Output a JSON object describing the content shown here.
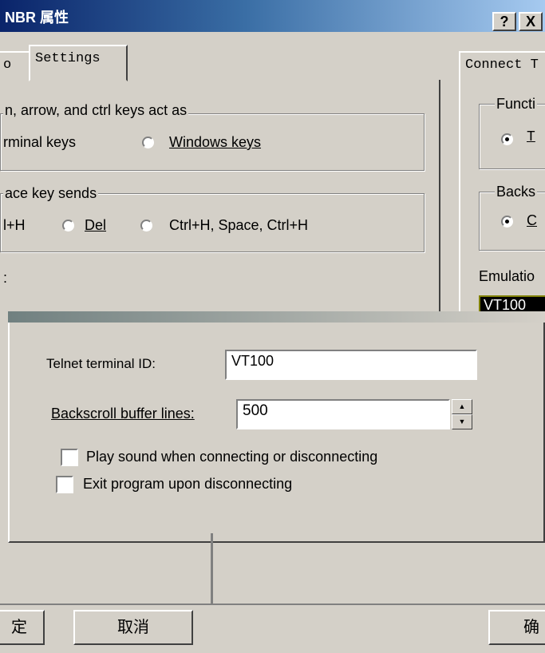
{
  "window": {
    "title": "NBR 属性",
    "help_btn": "?",
    "close_btn": "X"
  },
  "tabs": {
    "partial": "o",
    "settings": "Settings",
    "right_partial": "Connect T"
  },
  "left_panel": {
    "keys_group": "n, arrow, and ctrl keys act as",
    "terminal_keys": "rminal keys",
    "windows_keys": "Windows keys",
    "backspace_group": "ace key sends",
    "opt_ctrlh": "l+H",
    "opt_del": "Del",
    "opt_ctrlh_space": "Ctrl+H, Space, Ctrl+H",
    "colon_label": ":"
  },
  "right_panel": {
    "func_group": "Functi",
    "func_opt": "T",
    "back_group": "Backs",
    "back_opt": "C",
    "emulation_label": "Emulatio",
    "emulation_value": "VT100"
  },
  "dialog": {
    "terminal_id_label": "Telnet terminal ID:",
    "terminal_id_value": "VT100",
    "backscroll_label": "Backscroll buffer lines:",
    "backscroll_value": "500",
    "play_sound_label": "Play sound when connecting or disconnecting",
    "exit_label": "Exit program upon disconnecting"
  },
  "buttons": {
    "ok_partial": "定",
    "cancel": "取消",
    "ok_right": "确"
  },
  "colors": {
    "face": "#d4d0c8",
    "title_start": "#0a246a",
    "title_end": "#a6caf0"
  }
}
